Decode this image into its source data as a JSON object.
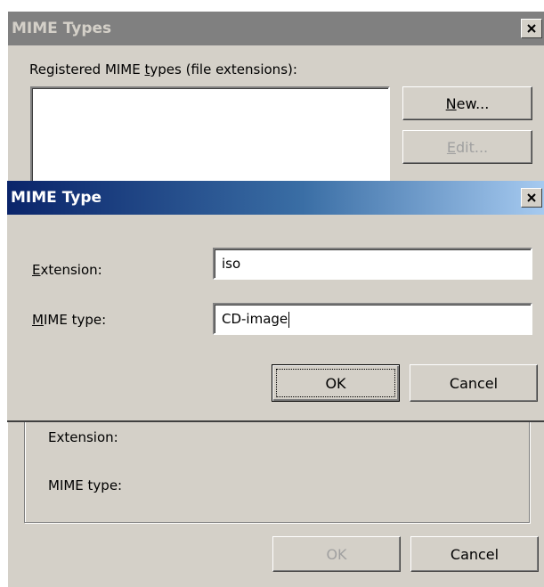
{
  "back_dialog": {
    "title": "MIME Types",
    "list_label": {
      "pre": "Registered MIME ",
      "accel": "t",
      "post": "ypes (file extensions):"
    },
    "new_button": {
      "pre": "",
      "accel": "N",
      "post": "ew..."
    },
    "edit_button": {
      "pre": "",
      "accel": "E",
      "post": "dit..."
    },
    "extension_label": "Extension:",
    "mime_type_label": "MIME type:",
    "ok_label": "OK",
    "cancel_label": "Cancel"
  },
  "front_dialog": {
    "title": "MIME Type",
    "extension_label": {
      "pre": "",
      "accel": "E",
      "post": "xtension:"
    },
    "extension_value": "iso",
    "mime_type_label": {
      "pre": "",
      "accel": "M",
      "post": "IME type:"
    },
    "mime_type_value": "CD-image",
    "ok_label": "OK",
    "cancel_label": "Cancel"
  },
  "icons": {
    "close": "close-icon"
  }
}
